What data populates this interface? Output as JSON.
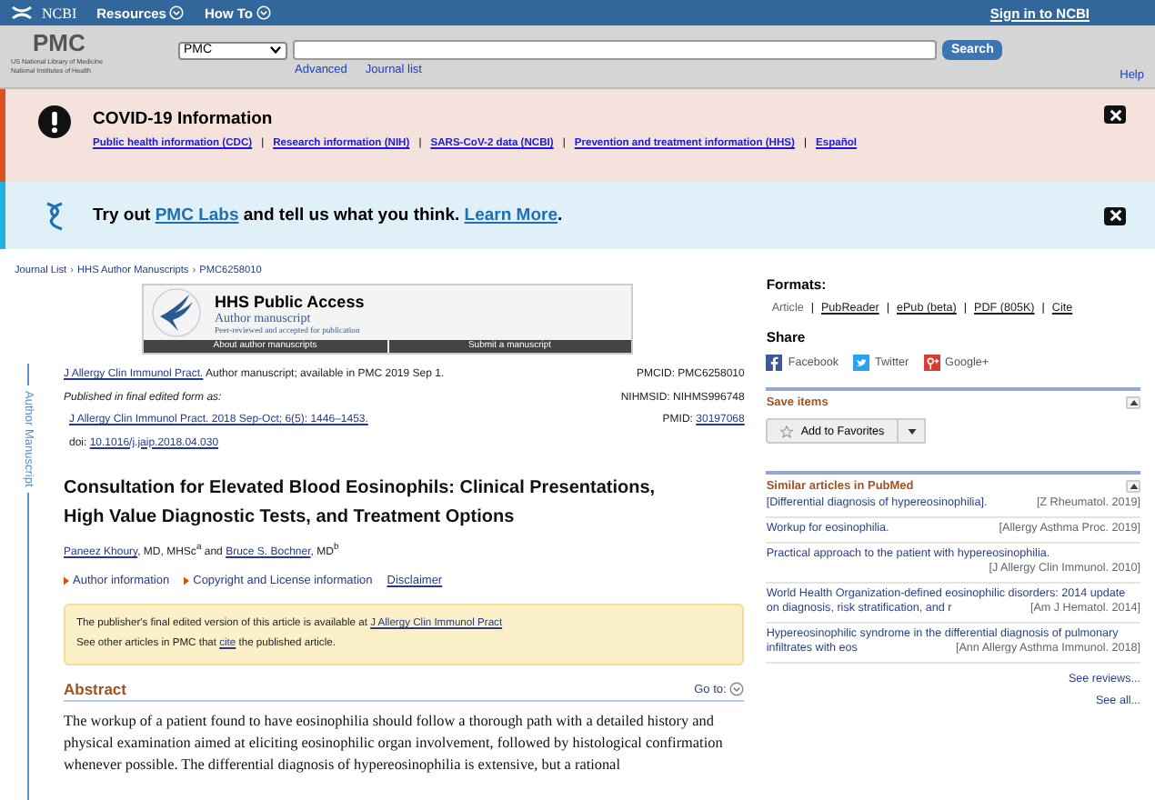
{
  "top_bar": {
    "logo": "NCBI",
    "menus": [
      "Resources",
      "How To"
    ],
    "sign_in": "Sign in to NCBI"
  },
  "header": {
    "logo": "PMC",
    "org_lines": [
      "US National Library of Medicine",
      "National Institutes of Health"
    ],
    "database": "PMC",
    "search_button": "Search",
    "links": [
      "Advanced",
      "Journal list"
    ],
    "help": "Help"
  },
  "banners": [
    {
      "kind": "alert",
      "title": "COVID-19 Information",
      "separator": "|",
      "links": [
        "Public health information (CDC)",
        "Research information (NIH)",
        "SARS-CoV-2 data (NCBI)",
        "Prevention and treatment information (HHS)",
        "Español"
      ]
    },
    {
      "kind": "info",
      "parts": [
        {
          "kind": "text",
          "text": "Try out "
        },
        {
          "kind": "link",
          "text": "PMC Labs"
        },
        {
          "kind": "text",
          "text": " and tell us what you think. "
        },
        {
          "kind": "link",
          "text": "Learn More"
        },
        {
          "kind": "text",
          "text": "."
        }
      ]
    }
  ],
  "breadcrumb": {
    "separator": "›",
    "items": [
      "Journal List",
      "HHS Author Manuscripts",
      "PMC6258010"
    ]
  },
  "hhs_box": {
    "title": "HHS Public Access",
    "subtitle": "Author manuscript",
    "tagline": "Peer-reviewed and accepted for publication",
    "buttons": [
      "About author manuscripts",
      "Submit a manuscript"
    ]
  },
  "side_label": "Author Manuscript",
  "citation": [
    {
      "kind": "plain",
      "parts": [
        {
          "kind": "link",
          "text": "J Allergy Clin Immunol Pract."
        },
        {
          "kind": "text",
          "text": " Author manuscript; available in PMC 2019 Sep 1."
        }
      ]
    },
    {
      "kind": "italic",
      "parts": [
        {
          "kind": "text",
          "text": "Published in final edited form as:"
        }
      ]
    },
    {
      "kind": "indent",
      "parts": [
        {
          "kind": "link",
          "text": "J Allergy Clin Immunol Pract. 2018 Sep-Oct; 6(5): 1446–1453."
        }
      ]
    },
    {
      "kind": "indent",
      "parts": [
        {
          "kind": "text",
          "text": "doi: "
        },
        {
          "kind": "link",
          "text": "10.1016/j.jaip.2018.04.030"
        }
      ]
    }
  ],
  "ids": [
    {
      "parts": [
        {
          "kind": "text",
          "text": "PMCID: PMC6258010"
        }
      ]
    },
    {
      "parts": [
        {
          "kind": "text",
          "text": "NIHMSID: NIHMS996748"
        }
      ]
    },
    {
      "parts": [
        {
          "kind": "text",
          "text": "PMID: "
        },
        {
          "kind": "link",
          "text": "30197068"
        }
      ]
    }
  ],
  "title": "Consultation for Elevated Blood Eosinophils: Clinical Presentations, High Value Diagnostic Tests, and Treatment Options",
  "authors": [
    {
      "kind": "link",
      "text": "Paneez Khoury"
    },
    {
      "kind": "text",
      "text": ", MD, MHSc$^{a}$ and "
    },
    {
      "kind": "link",
      "text": "Bruce S. Bochner"
    },
    {
      "kind": "text",
      "text": ", MD$^{b}$"
    }
  ],
  "info_links": [
    {
      "kind": "expander",
      "label": "Author information"
    },
    {
      "kind": "expander",
      "label": "Copyright and License information"
    },
    {
      "kind": "link",
      "label": "Disclaimer"
    }
  ],
  "notice": [
    [
      {
        "kind": "text",
        "text": "The publisher's final edited version of this article is available at "
      },
      {
        "kind": "link",
        "text": "J Allergy Clin Immunol Pract"
      }
    ],
    [
      {
        "kind": "text",
        "text": "See other articles in PMC that "
      },
      {
        "kind": "link",
        "text": "cite"
      },
      {
        "kind": "text",
        "text": " the published article."
      }
    ]
  ],
  "abstract": {
    "heading": "Abstract",
    "goto": "Go to:",
    "text": "The workup of a patient found to have eosinophilia should follow a thorough path with a detailed history and physical examination aimed at eliciting eosinophilic organ involvement, followed by histological confirmation whenever possible. The differential diagnosis of hypereosinophilia is extensive, but a rational"
  },
  "formats": {
    "heading": "Formats:",
    "separator": "|",
    "items": [
      {
        "label": "Article",
        "selected": true
      },
      {
        "label": "PubReader",
        "selected": false
      },
      {
        "label": "ePub (beta)",
        "selected": false
      },
      {
        "label": "PDF (805K)",
        "selected": false
      },
      {
        "label": "Cite",
        "selected": false
      }
    ]
  },
  "share": {
    "heading": "Share",
    "items": [
      {
        "kind": "facebook",
        "label": "Facebook"
      },
      {
        "kind": "twitter",
        "label": "Twitter"
      },
      {
        "kind": "google",
        "label": "Google+"
      }
    ]
  },
  "save_items": {
    "heading": "Save items",
    "button": "Add to Favorites"
  },
  "similar": {
    "heading": "Similar articles in PubMed",
    "items": [
      {
        "title": "[Differential diagnosis of hypereosinophilia].",
        "source": "[Z Rheumatol. 2019]"
      },
      {
        "title": "Workup for eosinophilia.",
        "source": "[Allergy Asthma Proc. 2019]"
      },
      {
        "title": "Practical approach to the patient with hypereosinophilia.",
        "source": "[J Allergy Clin Immunol. 2010]"
      },
      {
        "title": "World Health Organization-defined eosinophilic disorders: 2014 update on diagnosis, risk stratification, and r",
        "source": "[Am J Hematol. 2014]"
      },
      {
        "title": "Hypereosinophilic syndrome in the differential diagnosis of pulmonary infiltrates with eos",
        "source": "[Ann Allergy Asthma Immunol. 2018]"
      }
    ],
    "more": [
      "See reviews...",
      "See all..."
    ]
  }
}
